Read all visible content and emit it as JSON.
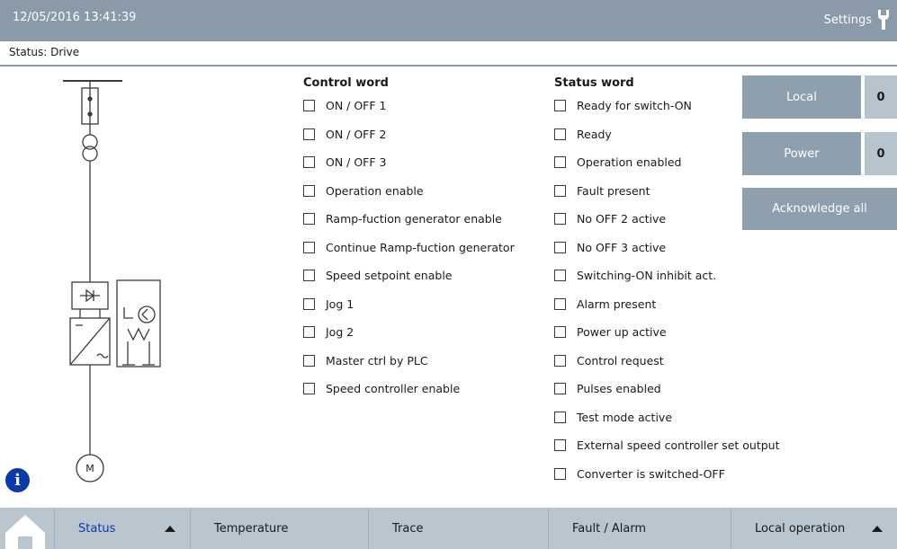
{
  "header": {
    "datetime": "12/05/2016 13:41:39",
    "settings_label": "Settings"
  },
  "status_bar": {
    "text": "Status: Drive"
  },
  "control_word": {
    "title": "Control word",
    "items": [
      "ON / OFF 1",
      "ON / OFF 2",
      "ON / OFF 3",
      "Operation enable",
      "Ramp-fuction generator enable",
      "Continue Ramp-fuction generator",
      "Speed setpoint enable",
      "Jog 1",
      "Jog 2",
      "Master ctrl by PLC",
      "Speed controller enable"
    ]
  },
  "status_word": {
    "title": "Status word",
    "items": [
      "Ready for switch-ON",
      "Ready",
      "Operation enabled",
      "Fault present",
      "No OFF 2 active",
      "No OFF 3 active",
      "Switching-ON inhibit act.",
      "Alarm present",
      "Power up active",
      "Control request",
      "Pulses enabled",
      "Test mode active",
      "External speed controller set output",
      "Converter is switched-OFF"
    ]
  },
  "buttons": {
    "local": "Local",
    "local_state": "0",
    "power": "Power",
    "power_state": "0",
    "acknowledge_all": "Acknowledge all"
  },
  "diagram": {
    "motor_label": "M"
  },
  "tabs": [
    "Status",
    "Temperature",
    "Trace",
    "Fault / Alarm",
    "Local operation"
  ],
  "colors": {
    "header": "#8a9aa8",
    "button": "#8e9fae",
    "tab_bar": "#b9c6d0",
    "active_tab": "#0a3aa8",
    "info": "#0a3aa8"
  }
}
